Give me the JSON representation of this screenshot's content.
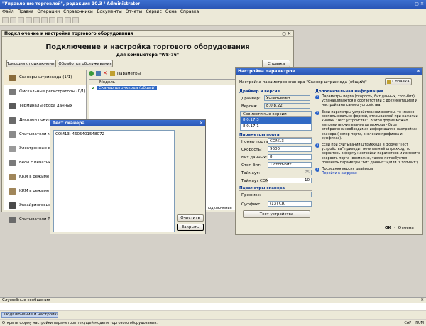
{
  "app": {
    "title": "\"Управление торговлей\", редакция 10.3 / Administrator"
  },
  "menu": [
    "Файл",
    "Правка",
    "Операции",
    "Справочники",
    "Документы",
    "Отчеты",
    "Сервис",
    "Окна",
    "Справка"
  ],
  "main_window": {
    "title": "Подключение и настройка торгового оборудования",
    "heading": "Подключение и настройка торгового оборудования",
    "subheading": "для компьютера \"WS-76\"",
    "btn_connect": "Помощник подключения",
    "btn_process": "Обработка обслуживания",
    "btn_help": "Справка",
    "list_params": "Параметры",
    "col_model": "Модель",
    "row_model": "Сканер штрихкода (общий)",
    "sidebar": [
      "Сканеры штрихкода (1/1)",
      "Фискальные регистраторы (0/1)",
      "Терминалы сбора данных",
      "Дисплеи покупателя",
      "Считыватели маг...",
      "Электронные вес...",
      "Весы с печатью э...",
      "ККМ в режиме О...",
      "ККМ в режиме О...",
      "Эквайринговые с...",
      "Считыватели RFI..."
    ],
    "status_strip": "...ить все подключения"
  },
  "settings": {
    "title": "Настройка параметров",
    "heading": "Настройка параметров сканера \"Сканер штрихкода (общий)\"",
    "help": "Справка",
    "driver_group": "Драйвер и версия",
    "driver_label": "Драйвер:",
    "driver_value": "Установлен",
    "version_label": "Версия:",
    "version_value": "8.0.8.22",
    "compat_header": "Совместимые версии",
    "compat_items": [
      "8.0.17.3",
      "8.0.17.1"
    ],
    "port_group": "Параметры порта",
    "port_num_label": "Номер порта:",
    "port_num_value": "COM13",
    "speed_label": "Скорость:",
    "speed_value": "9600",
    "bits_label": "Бит данных:",
    "bits_value": "8",
    "stopbit_label": "Стоп-бит:",
    "stopbit_value": "1 стоп-бит",
    "timeout_label": "Таймаут:",
    "timeout_value": "75",
    "timeoutcom_label": "Таймаут COM:",
    "timeoutcom_value": "10",
    "scanner_group": "Параметры сканера",
    "prefix_label": "Префикс:",
    "prefix_value": "",
    "suffix_label": "Суффикс:",
    "suffix_value": "(13) CR",
    "test_btn": "Тест устройства",
    "info_group": "Дополнительная информация",
    "info_paras": [
      "Параметры порта (скорость, бит данных, стоп-бит) устанавливаются в соответствии с документацией и настройками самого устройства.",
      "Если параметры устройства неизвестны, то можно воспользоваться формой, открываемой при нажатии кнопки \"Тест устройства\". В этой форме можно выполнить считывание штрихкода - будет отображена необходимая информация о настройках сканера (номер порта, значение префикса и суффикса).",
      "Если при считывании штрихкода в форме \"Тест устройства\" приходит нечитаемый штрихкод, то вернитесь в форму настройки параметров и измените скорость порта (возможно, также потребуется поменять параметры \"Бит данных\" и/или \"Стоп-бит\").",
      "Последняя версия драйвера"
    ],
    "link_download": "Перейти к загрузке",
    "ok": "OK",
    "cancel": "Отмена"
  },
  "test_dialog": {
    "title": "Тест сканера",
    "output": "COM13: 4605401548072",
    "clear": "Очистить",
    "close": "Закрыть"
  },
  "service": {
    "title": "Служебные сообщения"
  },
  "taskbar": {
    "item": "Подключение и настройка..."
  },
  "statusbar": {
    "text": "Открыть форму настройки параметров текущей модели торгового оборудования.",
    "cap": "CAP",
    "num": "NUM"
  }
}
